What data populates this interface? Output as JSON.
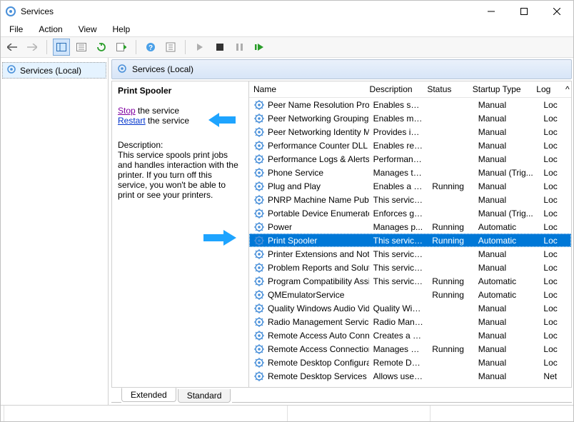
{
  "window": {
    "title": "Services"
  },
  "menu": {
    "file": "File",
    "action": "Action",
    "view": "View",
    "help": "Help"
  },
  "tree": {
    "root_label": "Services (Local)"
  },
  "header": {
    "label": "Services (Local)"
  },
  "infopanel": {
    "selected_name": "Print Spooler",
    "stop_link": "Stop",
    "stop_suffix": " the service",
    "restart_link": "Restart",
    "restart_suffix": " the service",
    "description_label": "Description:",
    "description_text": "This service spools print jobs and handles interaction with the printer. If you turn off this service, you won't be able to print or see your printers."
  },
  "columns": {
    "name": "Name",
    "description": "Description",
    "status": "Status",
    "startup": "Startup Type",
    "logon": "Log"
  },
  "services": [
    {
      "name": "Peer Name Resolution Prot...",
      "description": "Enables serv...",
      "status": "",
      "startup": "Manual",
      "logon": "Loc"
    },
    {
      "name": "Peer Networking Grouping",
      "description": "Enables mul...",
      "status": "",
      "startup": "Manual",
      "logon": "Loc"
    },
    {
      "name": "Peer Networking Identity M...",
      "description": "Provides ide...",
      "status": "",
      "startup": "Manual",
      "logon": "Loc"
    },
    {
      "name": "Performance Counter DLL ...",
      "description": "Enables rem...",
      "status": "",
      "startup": "Manual",
      "logon": "Loc"
    },
    {
      "name": "Performance Logs & Alerts",
      "description": "Performanc...",
      "status": "",
      "startup": "Manual",
      "logon": "Loc"
    },
    {
      "name": "Phone Service",
      "description": "Manages th...",
      "status": "",
      "startup": "Manual (Trig...",
      "logon": "Loc"
    },
    {
      "name": "Plug and Play",
      "description": "Enables a c...",
      "status": "Running",
      "startup": "Manual",
      "logon": "Loc"
    },
    {
      "name": "PNRP Machine Name Publi...",
      "description": "This service ...",
      "status": "",
      "startup": "Manual",
      "logon": "Loc"
    },
    {
      "name": "Portable Device Enumerator...",
      "description": "Enforces gr...",
      "status": "",
      "startup": "Manual (Trig...",
      "logon": "Loc"
    },
    {
      "name": "Power",
      "description": "Manages p...",
      "status": "Running",
      "startup": "Automatic",
      "logon": "Loc"
    },
    {
      "name": "Print Spooler",
      "description": "This service ...",
      "status": "Running",
      "startup": "Automatic",
      "logon": "Loc",
      "selected": true
    },
    {
      "name": "Printer Extensions and Notif...",
      "description": "This service ...",
      "status": "",
      "startup": "Manual",
      "logon": "Loc"
    },
    {
      "name": "Problem Reports and Soluti...",
      "description": "This service ...",
      "status": "",
      "startup": "Manual",
      "logon": "Loc"
    },
    {
      "name": "Program Compatibility Assi...",
      "description": "This service ...",
      "status": "Running",
      "startup": "Automatic",
      "logon": "Loc"
    },
    {
      "name": "QMEmulatorService",
      "description": "",
      "status": "Running",
      "startup": "Automatic",
      "logon": "Loc"
    },
    {
      "name": "Quality Windows Audio Vid...",
      "description": "Quality Win...",
      "status": "",
      "startup": "Manual",
      "logon": "Loc"
    },
    {
      "name": "Radio Management Service",
      "description": "Radio Mana...",
      "status": "",
      "startup": "Manual",
      "logon": "Loc"
    },
    {
      "name": "Remote Access Auto Conne...",
      "description": "Creates a co...",
      "status": "",
      "startup": "Manual",
      "logon": "Loc"
    },
    {
      "name": "Remote Access Connection...",
      "description": "Manages di...",
      "status": "Running",
      "startup": "Manual",
      "logon": "Loc"
    },
    {
      "name": "Remote Desktop Configurat...",
      "description": "Remote Des...",
      "status": "",
      "startup": "Manual",
      "logon": "Loc"
    },
    {
      "name": "Remote Desktop Services",
      "description": "Allows user...",
      "status": "",
      "startup": "Manual",
      "logon": "Net"
    }
  ],
  "tabs": {
    "extended": "Extended",
    "standard": "Standard"
  }
}
